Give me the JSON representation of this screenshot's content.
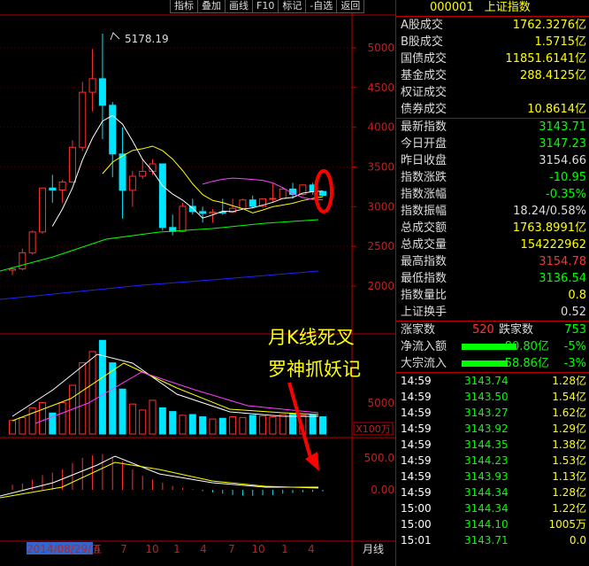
{
  "toolbar": {
    "buttons": [
      "指标",
      "叠加",
      "画线",
      "F10",
      "标记",
      "-自选",
      "返回"
    ]
  },
  "chart": {
    "high_label": "5178.19",
    "price_axis": [
      "5000",
      "4500",
      "4000",
      "3500",
      "3000",
      "2500",
      "2000"
    ],
    "volume_axis": [
      "5000"
    ],
    "volume_unit": "X100万",
    "macd_axis": [
      "500.0",
      "0.00"
    ],
    "x_labels": [
      "2014/08/29/五",
      "4",
      "7",
      "10",
      "1",
      "4",
      "7",
      "10",
      "1",
      "4"
    ],
    "period": "月线",
    "annotation_line1": "月K线死叉",
    "annotation_line2": "罗神抓妖记",
    "colors": {
      "up": "#ff3030",
      "down": "#00e5ff",
      "ma5": "#ffffff",
      "ma10": "#ffff00",
      "ma20": "#ff40ff",
      "ma30": "#00ff00",
      "ma60": "#2020ff"
    },
    "chart_data": {
      "type": "candlestick",
      "series_candles": [
        [
          2200,
          2217,
          2140,
          2237
        ],
        [
          2217,
          2420,
          2200,
          2470
        ],
        [
          2420,
          2682,
          2400,
          2700
        ],
        [
          2682,
          3235,
          2660,
          3240
        ],
        [
          3235,
          3210,
          3050,
          3400
        ],
        [
          3210,
          3310,
          3050,
          3340
        ],
        [
          3310,
          3748,
          3300,
          3835
        ],
        [
          3748,
          4441,
          3700,
          4572
        ],
        [
          4441,
          4611,
          4200,
          4986
        ],
        [
          4611,
          4277,
          3850,
          5178
        ],
        [
          4277,
          3664,
          3370,
          4318
        ],
        [
          3664,
          3206,
          2850,
          4000
        ],
        [
          3206,
          3383,
          3000,
          3450
        ],
        [
          3383,
          3445,
          3350,
          3600
        ],
        [
          3445,
          3539,
          3400,
          3600
        ],
        [
          3539,
          2738,
          2700,
          3539
        ],
        [
          2738,
          2688,
          2640,
          2900
        ],
        [
          2688,
          3004,
          2680,
          3050
        ],
        [
          3004,
          2938,
          2900,
          3100
        ],
        [
          2938,
          2916,
          2800,
          3000
        ],
        [
          2916,
          2932,
          2800,
          2970
        ],
        [
          2932,
          2929,
          2900,
          3100
        ],
        [
          2929,
          2979,
          2920,
          3100
        ],
        [
          2979,
          3085,
          3000,
          3100
        ],
        [
          3085,
          3005,
          2980,
          3140
        ],
        [
          3005,
          3100,
          2990,
          3100
        ],
        [
          3100,
          3104,
          3050,
          3290
        ],
        [
          3104,
          3222,
          3100,
          3250
        ],
        [
          3222,
          3154,
          3100,
          3300
        ],
        [
          3154,
          3273,
          3140,
          3280
        ],
        [
          3273,
          3192,
          3150,
          3300
        ],
        [
          3192,
          3143,
          3130,
          3200
        ]
      ],
      "volumes": [
        1800,
        2200,
        3500,
        4200,
        2800,
        4200,
        6500,
        9500,
        11000,
        12500,
        9500,
        6000,
        4000,
        3200,
        4500,
        3500,
        3000,
        2500,
        2600,
        2300,
        2000,
        2100,
        2300,
        2200,
        2500,
        2400,
        2300,
        2600,
        2700,
        2500,
        2600,
        2300
      ],
      "macd": [
        80,
        100,
        160,
        230,
        270,
        320,
        420,
        500,
        540,
        560,
        520,
        440,
        320,
        220,
        160,
        110,
        60,
        30,
        10,
        -20,
        -40,
        -60,
        -80,
        -90,
        -95,
        -85,
        -80,
        -60,
        -50,
        -40,
        -30,
        -25
      ]
    }
  },
  "panel": {
    "code": "000001",
    "name": "上证指数",
    "rows1": [
      {
        "label": "A股成交",
        "value": "1762.3276亿"
      },
      {
        "label": "B股成交",
        "value": "1.5715亿"
      },
      {
        "label": "国债成交",
        "value": "11851.6141亿"
      },
      {
        "label": "基金成交",
        "value": "288.4125亿"
      },
      {
        "label": "权证成交",
        "value": ""
      },
      {
        "label": "债券成交",
        "value": "10.8614亿"
      }
    ],
    "rows2": [
      {
        "label": "最新指数",
        "value": "3143.71",
        "color": "#0f0"
      },
      {
        "label": "今日开盘",
        "value": "3147.23",
        "color": "#0f0"
      },
      {
        "label": "昨日收盘",
        "value": "3154.66",
        "color": "#ddd"
      },
      {
        "label": "指数涨跌",
        "value": "-10.95",
        "color": "#0f0"
      },
      {
        "label": "指数涨幅",
        "value": "-0.35%",
        "color": "#0f0"
      },
      {
        "label": "指数振幅",
        "value": "18.24/0.58%",
        "color": "#ddd"
      },
      {
        "label": "总成交额",
        "value": "1763.8991亿",
        "color": "#ff0"
      },
      {
        "label": "总成交量",
        "value": "154222962",
        "color": "#ff0"
      },
      {
        "label": "最高指数",
        "value": "3154.78",
        "color": "#f33"
      },
      {
        "label": "最低指数",
        "value": "3136.54",
        "color": "#0f0"
      },
      {
        "label": "指数量比",
        "value": "0.8",
        "color": "#ff0"
      },
      {
        "label": "上证换手",
        "value": "0.52",
        "color": "#ddd"
      }
    ],
    "adv_label": "涨家数",
    "adv_value": "520",
    "dec_label": "跌家数",
    "dec_value": "753",
    "flow": [
      {
        "label": "净流入额",
        "value": "-80.80亿",
        "pct": "-5%"
      },
      {
        "label": "大宗流入",
        "value": "-58.86亿",
        "pct": "-3%"
      }
    ],
    "ticks": [
      {
        "time": "14:59",
        "price": "3143.74",
        "vol": "1.28亿"
      },
      {
        "time": "14:59",
        "price": "3143.50",
        "vol": "1.54亿"
      },
      {
        "time": "14:59",
        "price": "3143.27",
        "vol": "1.62亿"
      },
      {
        "time": "14:59",
        "price": "3143.92",
        "vol": "1.29亿"
      },
      {
        "time": "14:59",
        "price": "3144.35",
        "vol": "1.38亿"
      },
      {
        "time": "14:59",
        "price": "3144.23",
        "vol": "1.53亿"
      },
      {
        "time": "14:59",
        "price": "3143.93",
        "vol": "1.13亿"
      },
      {
        "time": "14:59",
        "price": "3144.34",
        "vol": "1.28亿"
      },
      {
        "time": "15:00",
        "price": "3144.34",
        "vol": "1.22亿"
      },
      {
        "time": "15:00",
        "price": "3144.10",
        "vol": "1005万"
      },
      {
        "time": "15:01",
        "price": "3143.71",
        "vol": "0.0"
      }
    ]
  }
}
